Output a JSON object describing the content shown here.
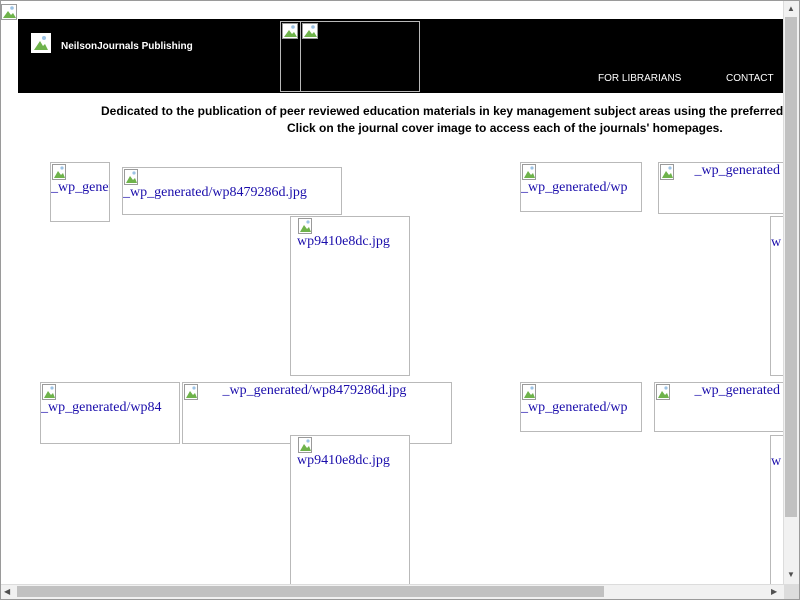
{
  "header": {
    "site_title": "NeilsonJournals Publishing",
    "nav": [
      {
        "label": "FOR LIBRARIANS"
      },
      {
        "label": "CONTACT"
      }
    ]
  },
  "intro": {
    "line1": "Dedicated to the publication of peer reviewed education materials in key management subject areas using the preferred",
    "line2": "Click on the journal cover image to access each of the journals' homepages."
  },
  "images": {
    "wp_generated_short": "_wp_gener",
    "wp_generated_mid": "_wp_generated/wp84",
    "wp_generated_wp": "_wp_generated/wp",
    "wp_generated_full": "_wp_generated/wp8479286d.jpg",
    "wp_generated_trunc": "_wp_generated",
    "wp9410": "wp9410e8dc.jpg",
    "w_fragment": "w"
  },
  "colors": {
    "header_bg": "#000000",
    "link_alt_text": "#1a0dab"
  }
}
